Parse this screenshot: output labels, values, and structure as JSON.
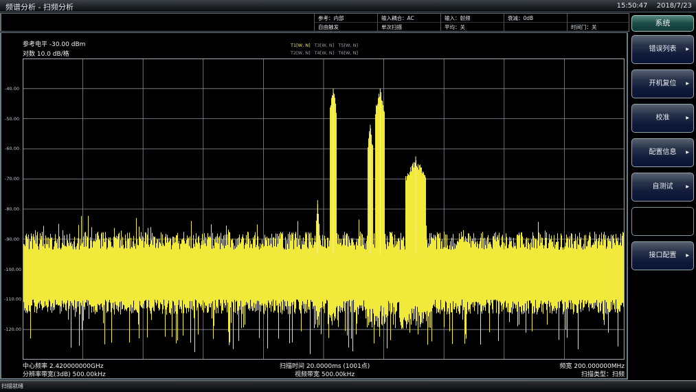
{
  "titlebar": {
    "title": "频谱分析 - 扫频分析",
    "time": "15:50:47",
    "date": "2018/7/23"
  },
  "infobar": {
    "row1": [
      "参考：内部",
      "输入耦合：AC",
      "输入：射频",
      "衰减：0dB",
      ""
    ],
    "row2": [
      "自由触发",
      "单次扫描",
      "平均：关",
      "",
      "时间门：关"
    ]
  },
  "header": {
    "ref_level": "参考电平 -30.00 dBm",
    "scale": "对数 10.0 dB/格",
    "traces_row1": [
      {
        "label": "T1[W, N]",
        "active": true
      },
      {
        "label": "T3[W, N]",
        "active": false
      },
      {
        "label": "T5[W, N]",
        "active": false
      }
    ],
    "traces_row2": [
      {
        "label": "T2[W, N]",
        "active": false
      },
      {
        "label": "T4[W, N]",
        "active": false
      },
      {
        "label": "T6[W, N]",
        "active": false
      }
    ]
  },
  "footer": {
    "center_freq": "中心频率 2.420000000GHz",
    "rbw": "分辨率带宽(3dB) 500.00kHz",
    "sweep_time": "扫描时间 20.0000ms (1001点)",
    "vbw": "视频带宽 500.00kHz",
    "span": "频宽 200.000000MHz",
    "sweep_type": "扫描类型：扫频"
  },
  "softkeys": {
    "menu_title": "系统",
    "items": [
      {
        "label": "错误列表",
        "arrow": "▶"
      },
      {
        "label": "开机复位",
        "arrow": "▶"
      },
      {
        "label": "校准",
        "arrow": "▶"
      },
      {
        "label": "配置信息",
        "arrow": "▶"
      },
      {
        "label": "自测试",
        "arrow": "▶"
      },
      {
        "label": "",
        "arrow": ""
      },
      {
        "label": "接口配置",
        "arrow": "▶"
      }
    ]
  },
  "statusbar": {
    "text": "扫描就绪"
  },
  "colors": {
    "trace": "#f2ea3a",
    "grid": "#8a8f93",
    "background": "#000000"
  },
  "chart_data": {
    "type": "line",
    "title": "",
    "xlabel": "",
    "ylabel": "dBm",
    "center_freq_ghz": 2.42,
    "span_mhz": 200,
    "points": 1001,
    "xlim_mhz": [
      2320,
      2520
    ],
    "ylim": [
      -130,
      -30
    ],
    "y_ticks": [
      -40,
      -50,
      -60,
      -70,
      -80,
      -90,
      -100,
      -110,
      -120
    ],
    "y_tick_labels": [
      "-40.00",
      "-50.00",
      "-60.00",
      "-70.00",
      "-80.00",
      "-90.00",
      "-100.00",
      "-110.00",
      "-120.00"
    ],
    "x_divisions": 10,
    "y_divisions": 10,
    "grid": true,
    "noise_floor": {
      "upper_dbm": -90,
      "lower_dbm": -110,
      "min_dbm": -121
    },
    "peaks": [
      {
        "freq_mhz": 2418.0,
        "level_dbm": -77.0,
        "width_mhz": 0.6
      },
      {
        "freq_mhz": 2423.2,
        "level_dbm": -40.0,
        "width_mhz": 1.2
      },
      {
        "freq_mhz": 2435.5,
        "level_dbm": -52.0,
        "width_mhz": 1.0
      },
      {
        "freq_mhz": 2438.8,
        "level_dbm": -40.0,
        "width_mhz": 1.6
      },
      {
        "freq_mhz": 2450.6,
        "level_dbm": -62.5,
        "width_mhz": 3.4
      }
    ],
    "trace_name": "T1"
  }
}
